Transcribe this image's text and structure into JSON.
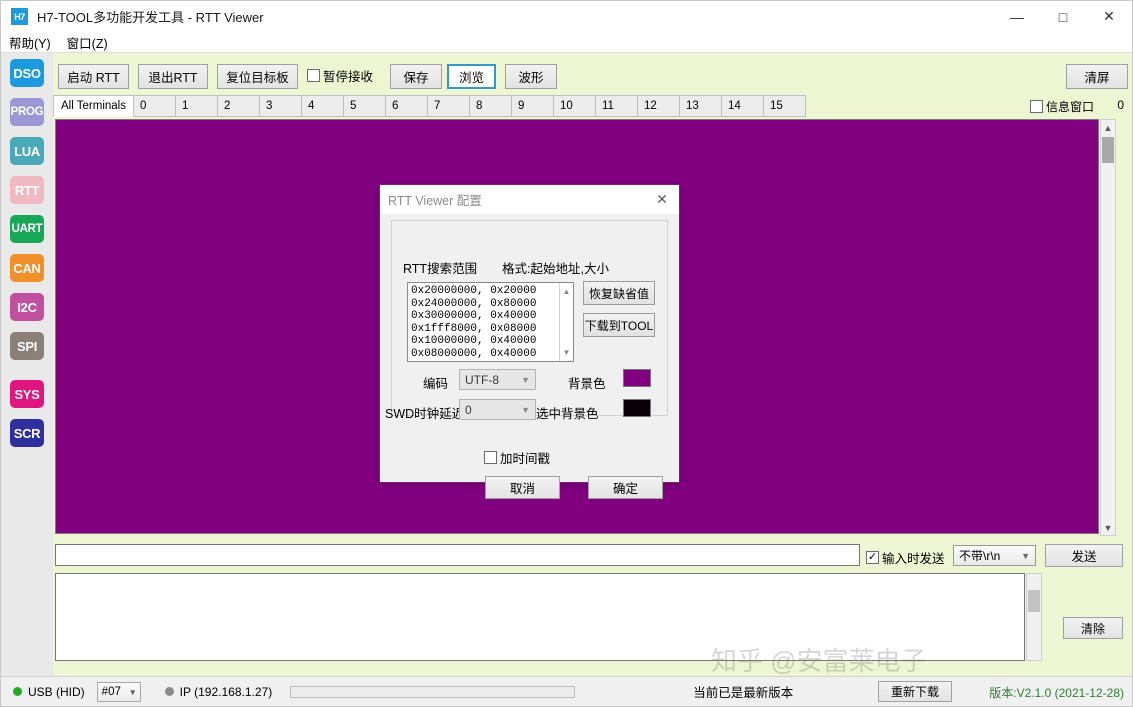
{
  "window": {
    "logo_text": "H7",
    "title": "H7-TOOL多功能开发工具 - RTT Viewer",
    "minimize": "—",
    "maximize": "□",
    "close": "✕"
  },
  "menubar": {
    "items": [
      {
        "label": "帮助(Y)"
      },
      {
        "label": "窗口(Z)"
      }
    ]
  },
  "sidebar": {
    "items": [
      {
        "label": "DSO",
        "color": "#1b9ae0"
      },
      {
        "label": "PROG",
        "color": "#9b97d4"
      },
      {
        "label": "LUA",
        "color": "#4aa9b8"
      },
      {
        "label": "RTT",
        "color": "#f0b8c0"
      },
      {
        "label": "UART",
        "color": "#17a757"
      },
      {
        "label": "CAN",
        "color": "#f0902a"
      },
      {
        "label": "I2C",
        "color": "#c0509f"
      },
      {
        "label": "SPI",
        "color": "#8a8078"
      },
      {
        "label": "SYS",
        "color": "#e0157f"
      },
      {
        "label": "SCR",
        "color": "#2f2f9e"
      }
    ]
  },
  "toolbar": {
    "start_rtt": "启动 RTT",
    "exit_rtt": "退出RTT",
    "reset_target": "复位目标板",
    "pause_receive": "暂停接收",
    "pause_checked": false,
    "save": "保存",
    "browse": "浏览",
    "waveform": "波形",
    "clear_screen": "清屏"
  },
  "tabs": {
    "all_terminals": "All Terminals",
    "numbers": [
      "0",
      "1",
      "2",
      "3",
      "4",
      "5",
      "6",
      "7",
      "8",
      "9",
      "10",
      "11",
      "12",
      "13",
      "14",
      "15"
    ],
    "active": "All Terminals",
    "info_window_label": "信息窗口",
    "info_window_checked": false,
    "info_count": "0"
  },
  "terminal": {
    "background_color": "#800080",
    "content": ""
  },
  "send_row": {
    "input_value": "",
    "send_on_input_label": "输入时发送",
    "send_on_input_checked": true,
    "newline_value": "不带\\r\\n",
    "send_button": "发送"
  },
  "log": {
    "content": "",
    "clear_button": "清除"
  },
  "watermark": {
    "text": "知乎 @安富莱电子"
  },
  "statusbar": {
    "usb_label": "USB (HID)",
    "usb_dot_color": "#22aa22",
    "device_id": "#07",
    "ip_label": "IP (192.168.1.27)",
    "ip_dot_color": "#8a8a8a",
    "update_text": "当前已是最新版本",
    "redownload_button": "重新下载",
    "version_text": "版本:V2.1.0 (2021-12-28)",
    "version_color": "#2e7d32"
  },
  "dialog": {
    "title": "RTT Viewer 配置",
    "close_icon": "✕",
    "label_search_range": "RTT搜索范围",
    "label_format": "格式:起始地址,大小",
    "address_entries": [
      "0x20000000,  0x20000",
      "0x24000000,  0x80000",
      "0x30000000,  0x40000",
      "0x1fff8000,  0x08000",
      "0x10000000,  0x40000",
      "0x08000000,  0x40000"
    ],
    "btn_restore_defaults": "恢复缺省值",
    "btn_download_tool": "下载到TOOL",
    "label_encoding": "编码",
    "encoding_value": "UTF-8",
    "label_swd_delay": "SWD时钟延迟",
    "swd_delay_value": "0",
    "label_bg_color": "背景色",
    "bg_color_value": "#800080",
    "label_sel_bg_color": "选中背景色",
    "sel_bg_color_value": "#0a0008",
    "label_timestamp": "加时间戳",
    "timestamp_checked": false,
    "btn_cancel": "取消",
    "btn_ok": "确定"
  }
}
